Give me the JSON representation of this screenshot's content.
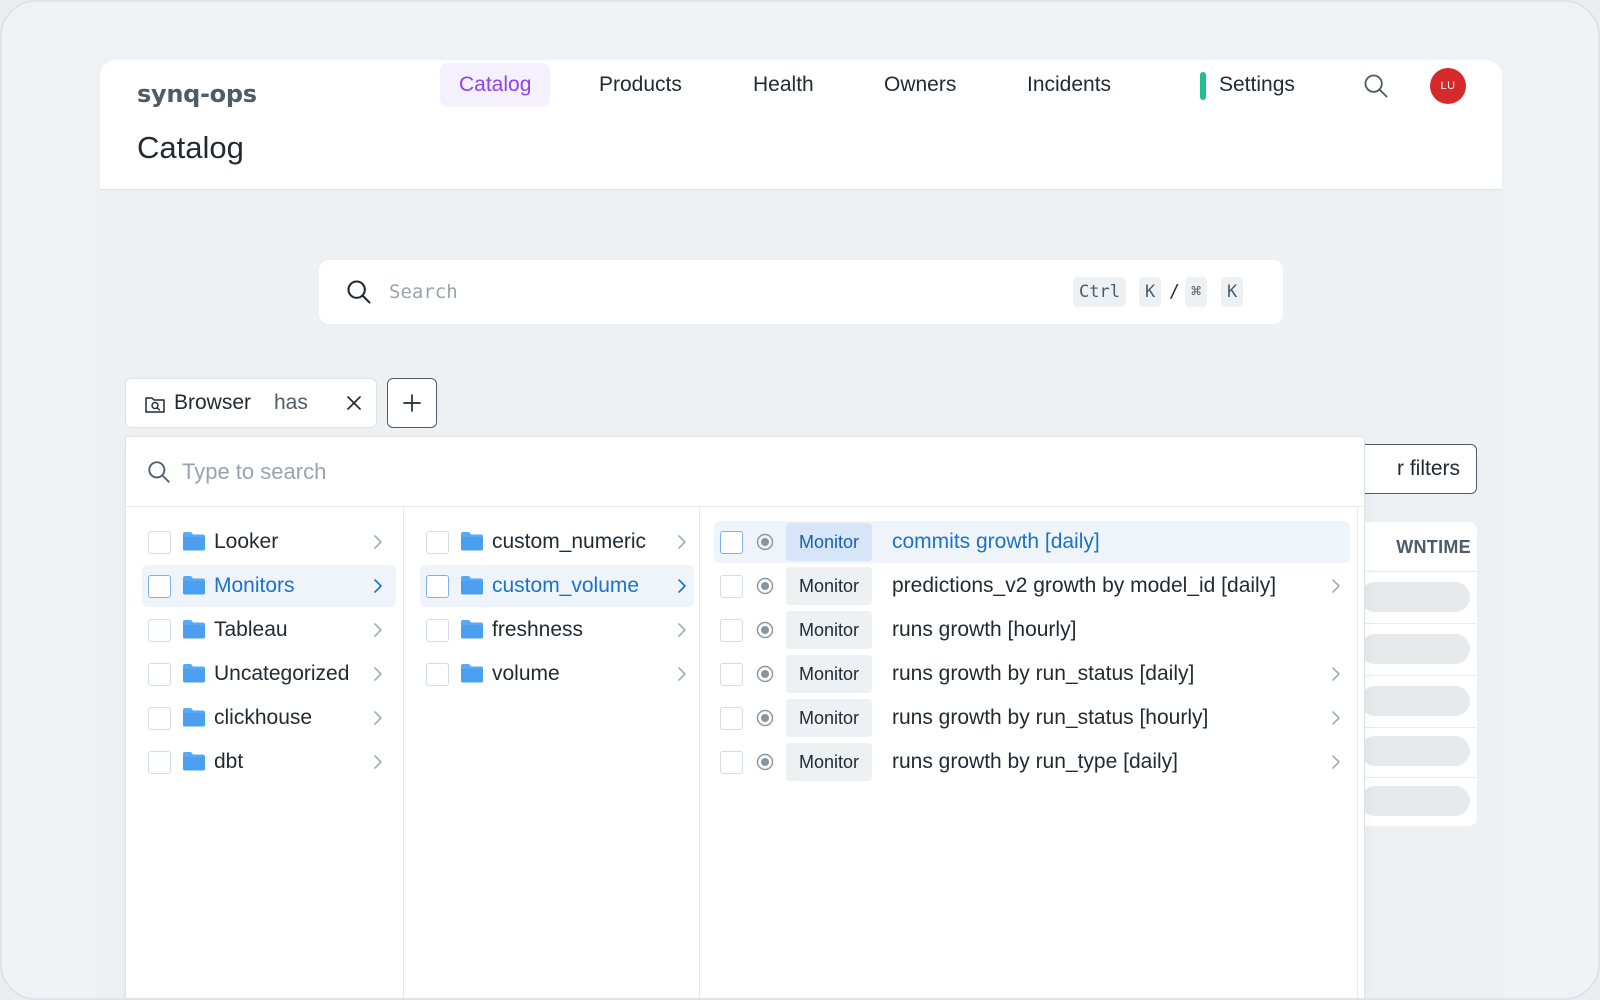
{
  "app": {
    "brand": "synq-ops",
    "page_title": "Catalog"
  },
  "nav": {
    "items": [
      {
        "label": "Catalog",
        "active": true
      },
      {
        "label": "Products",
        "active": false
      },
      {
        "label": "Health",
        "active": false
      },
      {
        "label": "Owners",
        "active": false
      },
      {
        "label": "Incidents",
        "active": false
      },
      {
        "label": "Settings",
        "active": false
      }
    ],
    "avatar_initials": "LU"
  },
  "colors": {
    "accent_purple": "#8e45e6",
    "link_blue": "#1a73c8",
    "settings_indicator": "#22c08e",
    "avatar_bg": "#d62a2a"
  },
  "search": {
    "placeholder": "Search",
    "shortcut": {
      "key1": "Ctrl",
      "key2": "K",
      "separator": "/",
      "key3": "⌘",
      "key4": "K"
    }
  },
  "filter": {
    "label": "Browser",
    "operator": "has",
    "icon": "folder-search-icon",
    "filters_button_label": "r filters",
    "table_header_partial": "WNTIME"
  },
  "browser": {
    "search_placeholder": "Type to search",
    "col1": [
      {
        "label": "Looker",
        "selected": false
      },
      {
        "label": "Monitors",
        "selected": true
      },
      {
        "label": "Tableau",
        "selected": false
      },
      {
        "label": "Uncategorized",
        "selected": false
      },
      {
        "label": "clickhouse",
        "selected": false
      },
      {
        "label": "dbt",
        "selected": false
      }
    ],
    "col2": [
      {
        "label": "custom_numeric",
        "selected": false
      },
      {
        "label": "custom_volume",
        "selected": true
      },
      {
        "label": "freshness",
        "selected": false
      },
      {
        "label": "volume",
        "selected": false
      }
    ],
    "col3": [
      {
        "tag": "Monitor",
        "label": "commits growth [daily]",
        "selected": true,
        "has_children": false
      },
      {
        "tag": "Monitor",
        "label": "predictions_v2 growth by model_id [daily]",
        "selected": false,
        "has_children": true
      },
      {
        "tag": "Monitor",
        "label": "runs growth [hourly]",
        "selected": false,
        "has_children": false
      },
      {
        "tag": "Monitor",
        "label": "runs growth by run_status [daily]",
        "selected": false,
        "has_children": true
      },
      {
        "tag": "Monitor",
        "label": "runs growth by run_status [hourly]",
        "selected": false,
        "has_children": true
      },
      {
        "tag": "Monitor",
        "label": "runs growth by run_type [daily]",
        "selected": false,
        "has_children": true
      }
    ]
  }
}
